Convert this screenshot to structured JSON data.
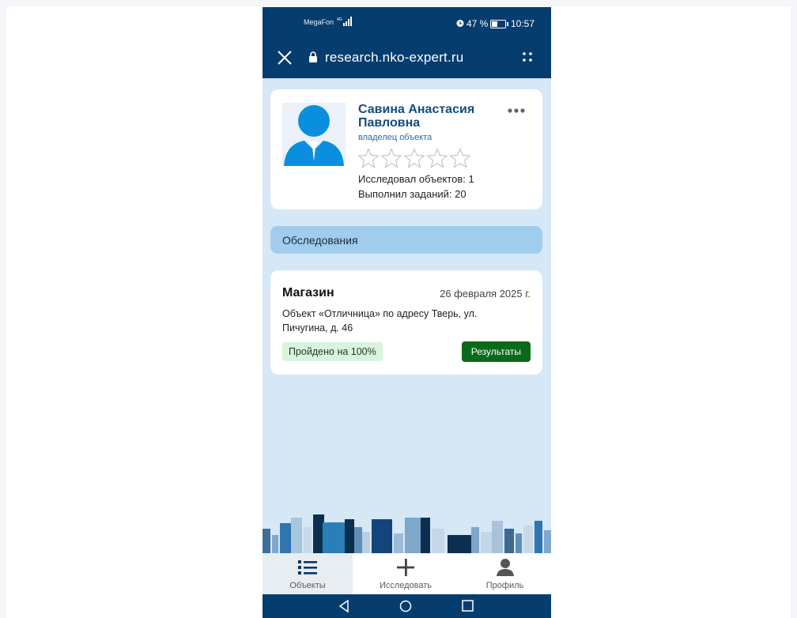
{
  "status_bar": {
    "carrier": "MegaFon",
    "battery_percent": "47 %",
    "time": "10:57"
  },
  "browser": {
    "url": "research.nko-expert.ru"
  },
  "profile": {
    "name": "Савина Анастасия Павловна",
    "role": "владелец объекта",
    "rating_stars": 0,
    "rating_max": 5,
    "objects_researched": "Исследовал объектов: 1",
    "tasks_done": "Выполнил заданий: 20"
  },
  "section": {
    "title": "Обследования"
  },
  "survey": {
    "title": "Магазин",
    "date": "26 февраля 2025 г.",
    "description": "Объект «Отличница» по адресу Тверь, ул. Пичугина, д. 46",
    "progress_label": "Пройдено на 100%",
    "results_button": "Результаты"
  },
  "bottom_nav": {
    "items": [
      {
        "label": "Объекты",
        "icon": "list-icon",
        "active": true
      },
      {
        "label": "Исследовать",
        "icon": "plus-icon",
        "active": false
      },
      {
        "label": "Профиль",
        "icon": "person-icon",
        "active": false
      }
    ]
  },
  "colors": {
    "header": "#063d6f",
    "name": "#114d80",
    "section_bar": "#a0cdee",
    "page_bg": "#d6e7f6",
    "results_button": "#0b6a1a",
    "badge_bg": "#d9f4dc"
  }
}
